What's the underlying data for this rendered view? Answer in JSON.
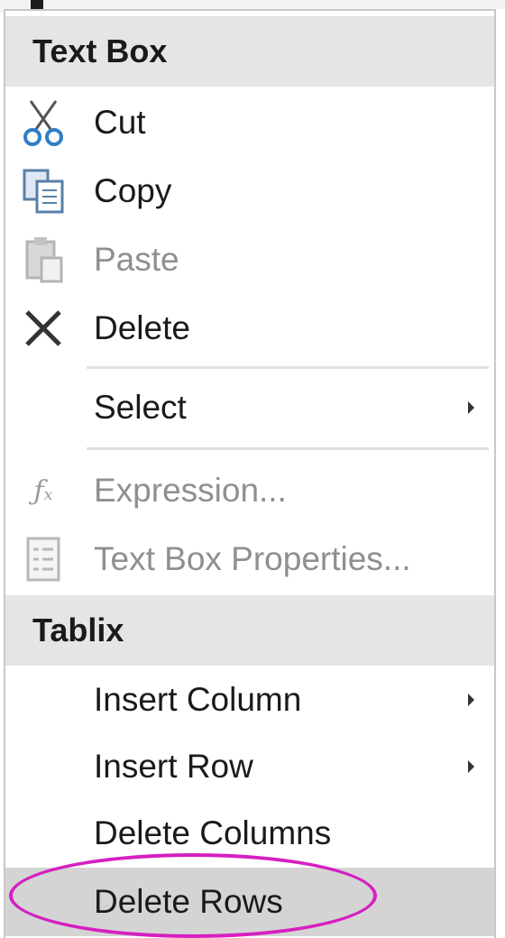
{
  "context_menu": {
    "sections": {
      "textbox": {
        "header": "Text Box"
      },
      "tablix": {
        "header": "Tablix"
      }
    },
    "items": {
      "cut": {
        "label": "Cut",
        "icon": "scissors-icon",
        "enabled": true
      },
      "copy": {
        "label": "Copy",
        "icon": "copy-icon",
        "enabled": true
      },
      "paste": {
        "label": "Paste",
        "icon": "paste-icon",
        "enabled": false
      },
      "delete": {
        "label": "Delete",
        "icon": "delete-x-icon",
        "enabled": true
      },
      "select": {
        "label": "Select",
        "has_submenu": true,
        "enabled": true
      },
      "expression": {
        "label": "Expression...",
        "icon": "fx-icon",
        "enabled": false
      },
      "textbox_properties": {
        "label": "Text Box Properties...",
        "icon": "properties-icon",
        "enabled": false
      },
      "insert_column": {
        "label": "Insert Column",
        "has_submenu": true,
        "enabled": true
      },
      "insert_row": {
        "label": "Insert Row",
        "has_submenu": true,
        "enabled": true
      },
      "delete_columns": {
        "label": "Delete Columns",
        "enabled": true
      },
      "delete_rows": {
        "label": "Delete Rows",
        "enabled": true,
        "highlighted": true
      }
    }
  },
  "colors": {
    "header_bg": "#e5e5e5",
    "highlight_bg": "#d4d4d4",
    "annotation_circle": "#d61fc1",
    "disabled_text": "#8f8f8f"
  }
}
